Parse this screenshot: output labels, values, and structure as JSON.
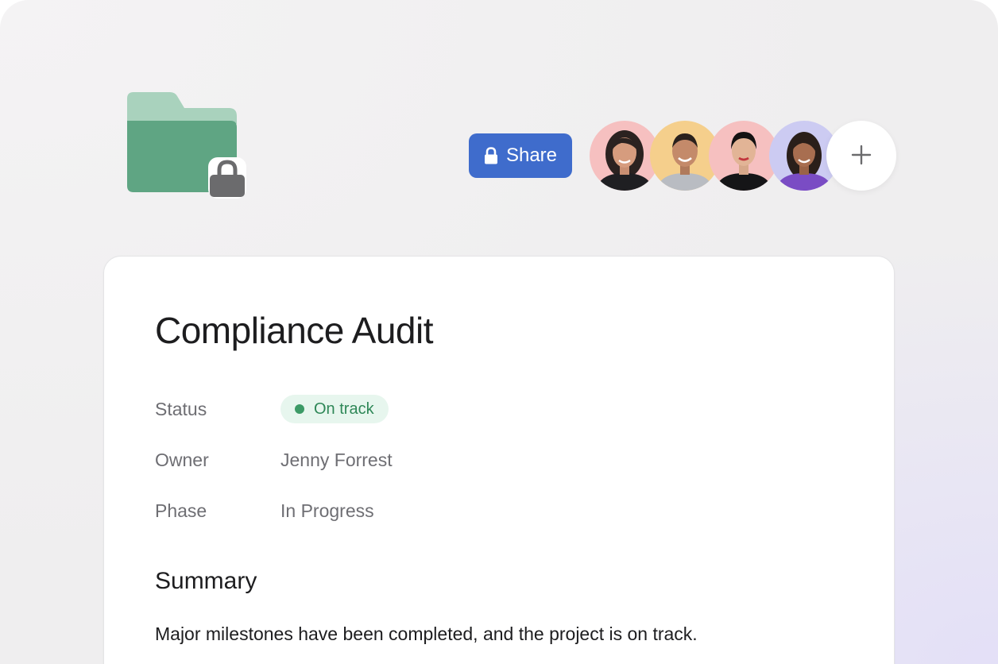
{
  "header": {
    "share_label": "Share",
    "colors": {
      "folder": "#5fa583",
      "folder_tab": "#a9d2bd",
      "share_button": "#3f6ccc"
    }
  },
  "members": [
    {
      "name": "member-1",
      "bg": "#f6c0c0"
    },
    {
      "name": "member-2",
      "bg": "#f5cf8c"
    },
    {
      "name": "member-3",
      "bg": "#f6c0c0"
    },
    {
      "name": "member-4",
      "bg": "#cccbf2"
    }
  ],
  "project": {
    "title": "Compliance Audit",
    "fields": {
      "status_label": "Status",
      "status_value": "On track",
      "owner_label": "Owner",
      "owner_value": "Jenny Forrest",
      "phase_label": "Phase",
      "phase_value": "In Progress"
    },
    "summary_heading": "Summary",
    "summary_text": "Major milestones have been completed, and the project is on track.",
    "status_color": "#3c9a66"
  },
  "icons": {
    "folder": "folder-icon",
    "folder_lock": "lock-icon",
    "share_lock": "lock-icon",
    "add": "plus-icon"
  }
}
